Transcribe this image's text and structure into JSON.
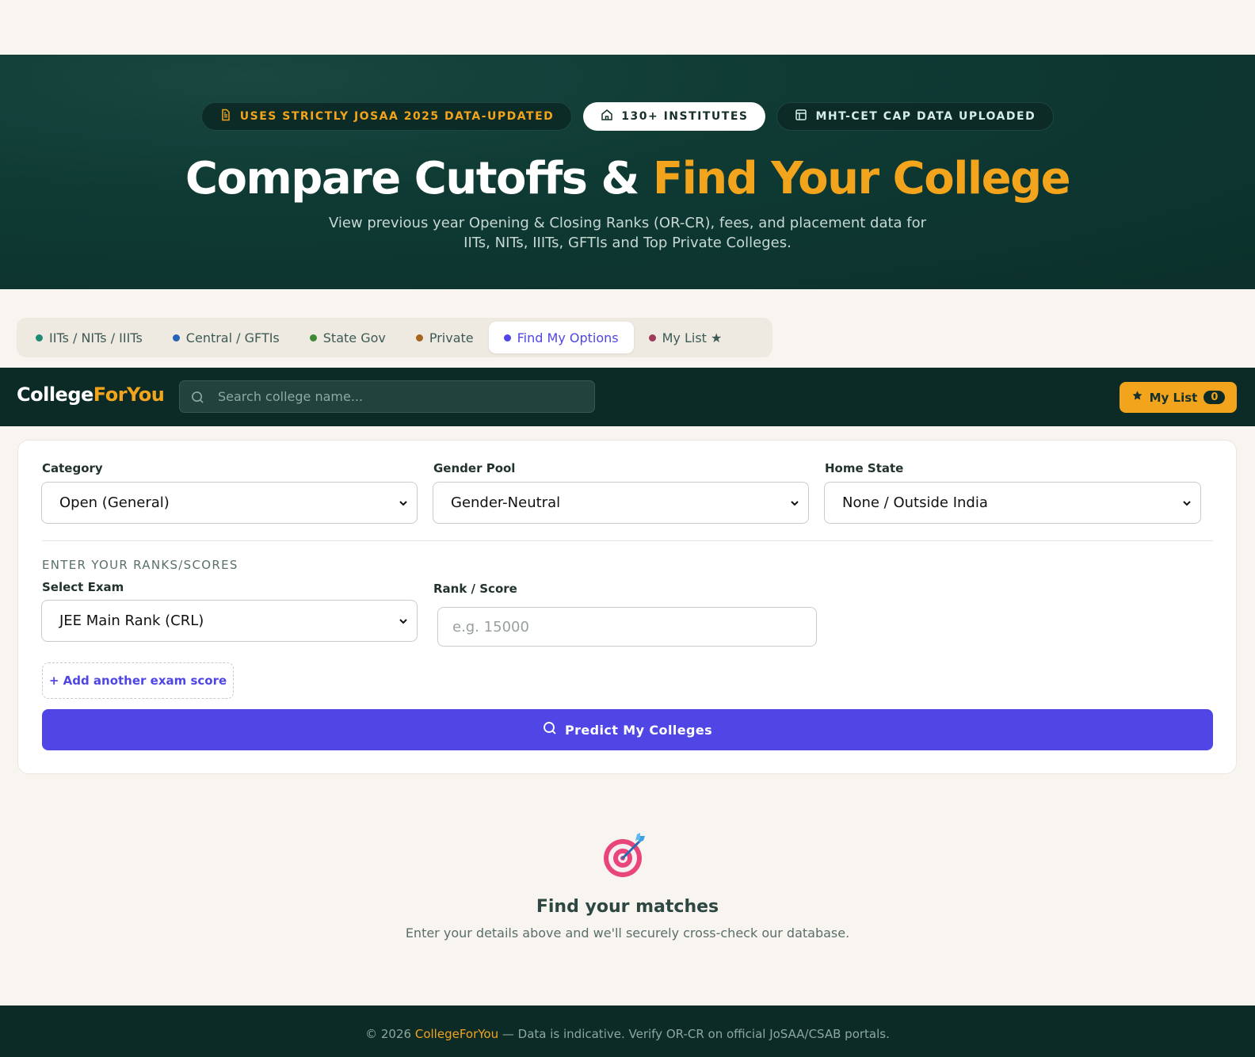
{
  "hero": {
    "pills": [
      {
        "label": "USES STRICTLY JOSAA 2025 DATA-UPDATED",
        "icon": "document-icon"
      },
      {
        "label": "130+ INSTITUTES",
        "icon": "home-icon"
      },
      {
        "label": "MHT-CET CAP DATA UPLOADED",
        "icon": "table-icon"
      }
    ],
    "title_main": "Compare Cutoffs &",
    "title_accent": "Find Your College",
    "subtitle_line1": "View previous year Opening & Closing Ranks (OR-CR), fees, and placement data for",
    "subtitle_line2": "IITs, NITs, IIITs, GFTIs and Top Private Colleges."
  },
  "tabs": [
    {
      "label": "IITs / NITs / IIITs",
      "dot": "#1f8a73"
    },
    {
      "label": "Central / GFTIs",
      "dot": "#2563b8"
    },
    {
      "label": "State Gov",
      "dot": "#3c8b34"
    },
    {
      "label": "Private",
      "dot": "#a8641c"
    },
    {
      "label": "Find My Options",
      "dot": "#4f46e5"
    },
    {
      "label": "My List ★",
      "dot": "#a23a5c"
    }
  ],
  "navbar": {
    "logo_main": "College",
    "logo_accent": "ForYou",
    "search_placeholder": "Search college name...",
    "mylist_label": "My List",
    "mylist_count": "0"
  },
  "form": {
    "category_label": "Category",
    "category_value": "Open (General)",
    "gender_label": "Gender Pool",
    "gender_value": "Gender-Neutral",
    "state_label": "Home State",
    "state_value": "None / Outside India",
    "section_heading": "ENTER YOUR RANKS/SCORES",
    "exam_label": "Select Exam",
    "exam_value": "JEE Main Rank (CRL)",
    "rank_label": "Rank / Score",
    "rank_placeholder": "e.g. 15000",
    "add_exam_label": "+ Add another exam score",
    "predict_label": "Predict My Colleges"
  },
  "empty_state": {
    "icon": "target-icon",
    "title": "Find your matches",
    "subtitle": "Enter your details above and we'll securely cross-check our database."
  },
  "footer": {
    "prefix": "© 2026",
    "brand": "CollegeForYou",
    "suffix": "— Data is indicative. Verify OR-CR on official JoSAA/CSAB portals."
  },
  "colors": {
    "primary_dark": "#0c2b27",
    "accent_orange": "#f2a41c",
    "accent_indigo": "#4f46e5",
    "page_bg": "#f8f5f0"
  }
}
